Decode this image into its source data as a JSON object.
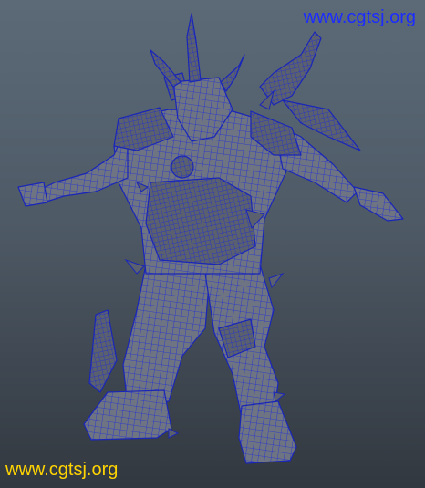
{
  "viewport": {
    "background_top": "#5c6a78",
    "background_bottom": "#32383f",
    "wire_color": "#1f2dd9",
    "mesh_fill": "#6e7482",
    "mesh_fill_dark": "#4f5562",
    "model_subject": "armored horned warrior character, wireframe on shaded, T-pose"
  },
  "watermarks": {
    "top_text": "www.cgtsj.org",
    "top_color": "#1c2cff",
    "bottom_text": "www.cgtsj.org",
    "bottom_color": "#ffd400"
  }
}
